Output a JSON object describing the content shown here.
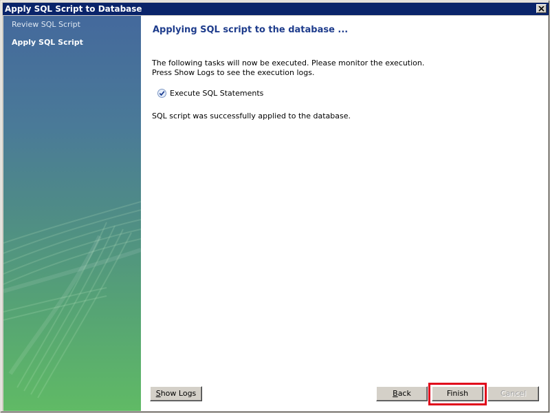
{
  "window": {
    "title": "Apply SQL Script to Database"
  },
  "sidebar": {
    "items": [
      {
        "label": "Review SQL Script",
        "active": false
      },
      {
        "label": "Apply SQL Script",
        "active": true
      }
    ]
  },
  "main": {
    "heading": "Applying SQL script to the database ...",
    "description_line1": "The following tasks will now be executed. Please monitor the execution.",
    "description_line2": "Press Show Logs to see the execution logs.",
    "tasks": [
      {
        "label": "Execute SQL Statements",
        "status_icon": "check-circle-icon"
      }
    ],
    "result_message": "SQL script was successfully applied to the database."
  },
  "buttons": {
    "show_logs": {
      "mnemonic": "S",
      "rest": "how Logs"
    },
    "back": {
      "mnemonic": "B",
      "rest": "ack"
    },
    "finish": {
      "label": "Finish"
    },
    "cancel": {
      "label": "Cancel",
      "disabled": true
    }
  },
  "colors": {
    "titlebar": "#0a246a",
    "heading": "#1e3c8c",
    "highlight": "#e0001a"
  }
}
